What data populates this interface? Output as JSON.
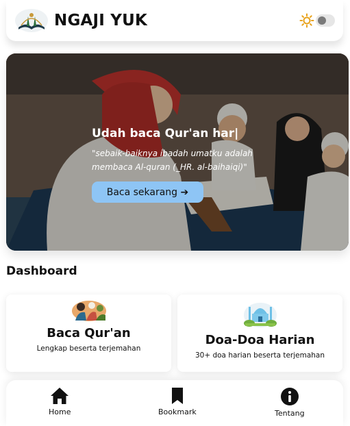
{
  "header": {
    "app_title": "NGAJI YUK",
    "logo_icon": "quran-book-logo-icon",
    "theme_icon": "sun-icon"
  },
  "hero": {
    "title": "Udah baca Qur'an har|",
    "quote": "\"sebaik-baiknya ibadah umatku adalah membaca Al-quran (_HR. al-baihaiqi)\"",
    "button_label": "Baca sekarang ➔",
    "button_color": "#8ec5f5"
  },
  "dashboard": {
    "title": "Dashboard",
    "cards": [
      {
        "title": "Baca Qur'an",
        "subtitle": "Lengkap beserta terjemahan",
        "icon": "reading-people-illustration"
      },
      {
        "title": "Doa-Doa Harian",
        "subtitle": "30+ doa harian beserta terjemahan",
        "icon": "mosque-illustration"
      }
    ]
  },
  "bottom_nav": {
    "items": [
      {
        "label": "Home",
        "icon": "home-icon"
      },
      {
        "label": "Bookmark",
        "icon": "bookmark-icon"
      },
      {
        "label": "Tentang",
        "icon": "info-icon"
      }
    ]
  }
}
